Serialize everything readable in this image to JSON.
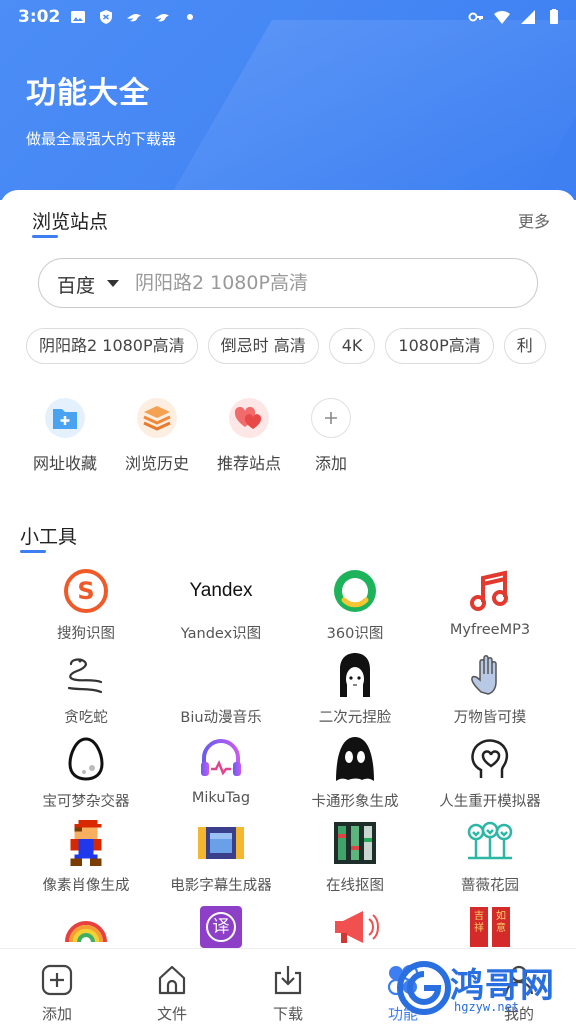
{
  "status_bar": {
    "time": "3:02",
    "icons_left": [
      "image-icon",
      "shield-icon",
      "bird-icon",
      "bird-icon",
      "dot-icon"
    ],
    "icons_right": [
      "key-icon",
      "wifi-icon",
      "signal-icon",
      "battery-icon"
    ]
  },
  "header": {
    "title": "功能大全",
    "subtitle": "做最全最强大的下载器",
    "color": "#4c8df6"
  },
  "browse": {
    "title": "浏览站点",
    "more": "更多",
    "engine": "百度",
    "search_placeholder": "阴阳路2 1080P高清",
    "chips": [
      "阴阳路2 1080P高清",
      "倒忌时 高清",
      "4K",
      "1080P高清",
      "利"
    ],
    "quick": [
      {
        "label": "网址收藏",
        "icon": "folder-plus-icon"
      },
      {
        "label": "浏览历史",
        "icon": "layers-icon"
      },
      {
        "label": "推荐站点",
        "icon": "hearts-icon"
      },
      {
        "label": "添加",
        "icon": "plus-icon"
      }
    ]
  },
  "tools": {
    "title": "小工具",
    "items": [
      {
        "label": "搜狗识图",
        "icon": "sogou-icon"
      },
      {
        "label": "Yandex识图",
        "icon": "yandex-icon",
        "logo_text": "Yandex"
      },
      {
        "label": "360识图",
        "icon": "360-icon"
      },
      {
        "label": "MyfreeMP3",
        "icon": "music-note-icon"
      },
      {
        "label": "贪吃蛇",
        "icon": "snake-icon"
      },
      {
        "label": "Biu动漫音乐",
        "icon": "blank-icon"
      },
      {
        "label": "二次元捏脸",
        "icon": "anime-face-icon"
      },
      {
        "label": "万物皆可摸",
        "icon": "hand-icon"
      },
      {
        "label": "宝可梦杂交器",
        "icon": "egg-icon"
      },
      {
        "label": "MikuTag",
        "icon": "headphones-icon"
      },
      {
        "label": "卡通形象生成",
        "icon": "ghost-face-icon"
      },
      {
        "label": "人生重开模拟器",
        "icon": "heart-head-icon"
      },
      {
        "label": "像素肖像生成",
        "icon": "pixel-mario-icon"
      },
      {
        "label": "电影字幕生成器",
        "icon": "film-icon"
      },
      {
        "label": "在线抠图",
        "icon": "film-strip-icon"
      },
      {
        "label": "蔷薇花园",
        "icon": "trees-icon"
      },
      {
        "label": "",
        "icon": "rainbow-icon"
      },
      {
        "label": "",
        "icon": "translate-icon",
        "logo_text": "译"
      },
      {
        "label": "",
        "icon": "megaphone-icon"
      },
      {
        "label": "",
        "icon": "couplet-icon",
        "logo_text": [
          "吉祥",
          "如意"
        ]
      }
    ]
  },
  "tabbar": {
    "items": [
      {
        "label": "添加",
        "icon": "add-square-icon"
      },
      {
        "label": "文件",
        "icon": "home-icon"
      },
      {
        "label": "下载",
        "icon": "download-icon"
      },
      {
        "label": "功能",
        "icon": "function-icon"
      },
      {
        "label": "我的",
        "icon": "person-icon"
      }
    ],
    "active_index": 3,
    "accent": "#3d7ff2"
  },
  "watermark": {
    "text": "鸿哥网",
    "url": "hgzyw.net"
  }
}
